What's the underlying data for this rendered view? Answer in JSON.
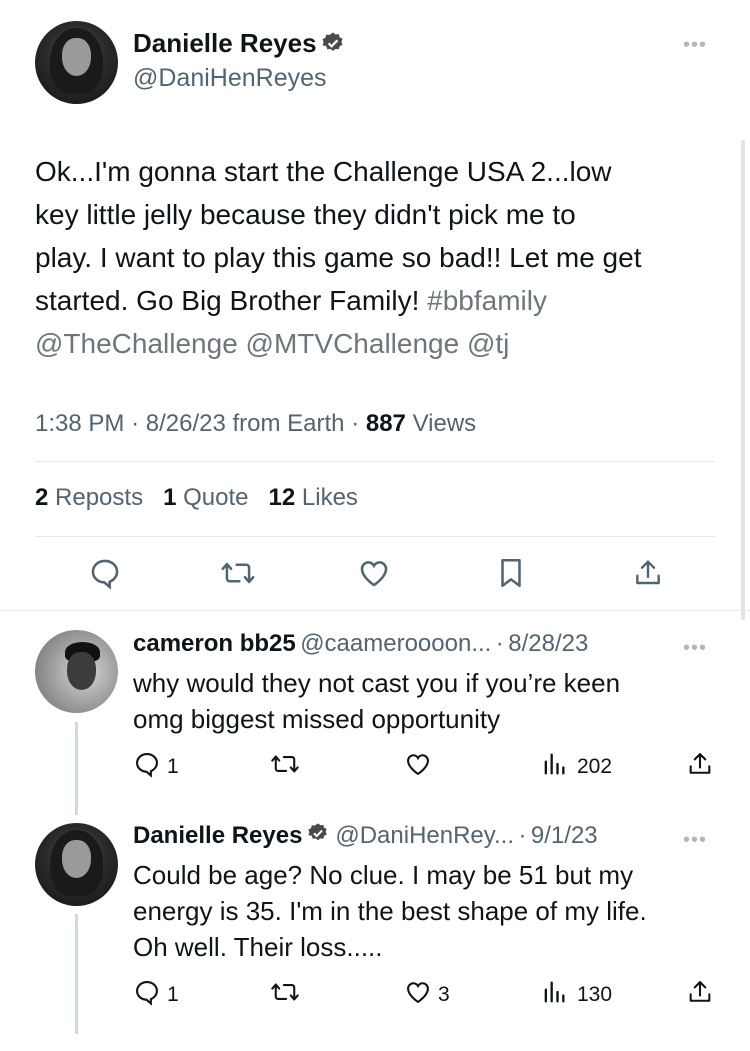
{
  "main_tweet": {
    "author": {
      "name": "Danielle Reyes",
      "handle": "@DaniHenReyes"
    },
    "text_lines": [
      "Ok...I'm gonna start the Challenge USA 2...low",
      "key little jelly because they didn't pick me to",
      "play. I want to play this game so bad!! Let me get",
      "started. Go Big Brother Family! "
    ],
    "hashtag": "#bbfamily",
    "mentions": "@TheChallenge @MTVChallenge @tj",
    "time": "1:38 PM",
    "date": "8/26/23",
    "source": "from Earth",
    "views_count": "887",
    "views_label": "Views",
    "reposts_count": "2",
    "reposts_label": "Reposts",
    "quotes_count": "1",
    "quotes_label": "Quote",
    "likes_count": "12",
    "likes_label": "Likes"
  },
  "replies": [
    {
      "name": "cameron bb25",
      "handle": "@caameroooon...",
      "date": "8/28/23",
      "lines": [
        "why would they not cast you if you’re keen",
        "omg biggest missed opportunity"
      ],
      "reply_count": "1",
      "like_count": "",
      "views": "202"
    },
    {
      "name": "Danielle Reyes",
      "handle": "@DaniHenRey...",
      "date": "9/1/23",
      "lines": [
        "Could be age? No clue. I may be 51 but my",
        "energy is 35. I'm in the best shape of my life.",
        "Oh well. Their loss....."
      ],
      "reply_count": "1",
      "like_count": "3",
      "views": "130"
    }
  ],
  "ui": {
    "more": "•••",
    "dot": "·"
  },
  "colors": {
    "text": "#0f1419",
    "muted": "#536471",
    "divider": "#e7e7e7"
  }
}
